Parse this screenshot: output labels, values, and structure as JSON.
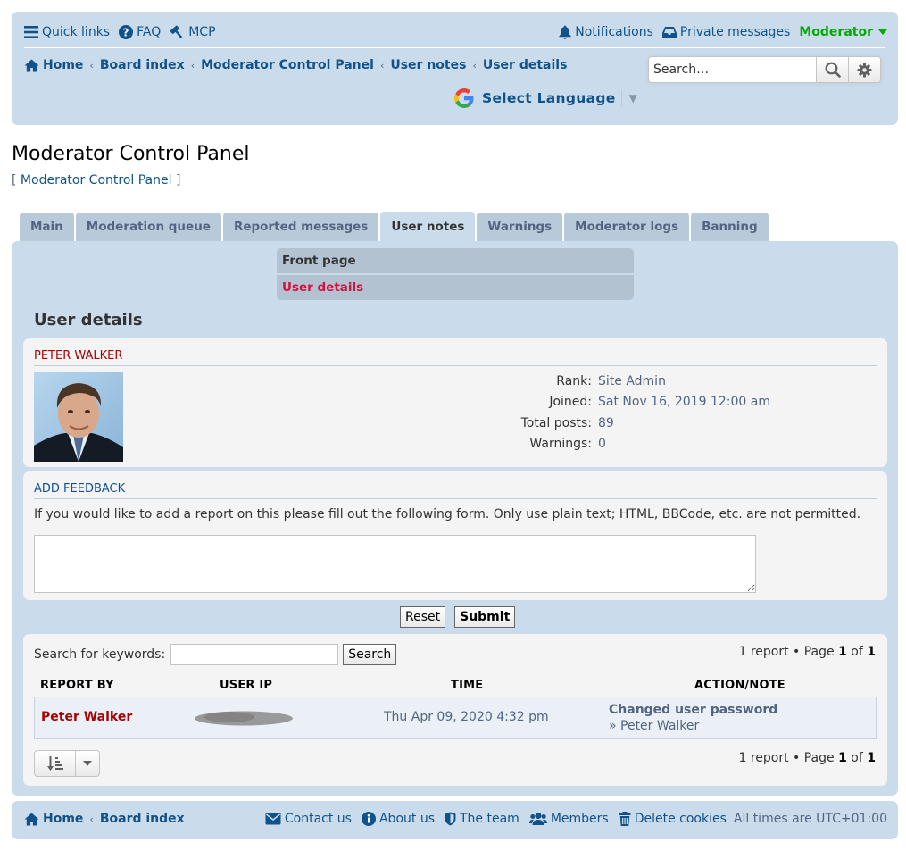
{
  "header": {
    "quick_links": "Quick links",
    "faq": "FAQ",
    "mcp": "MCP",
    "notifications": "Notifications",
    "private_messages": "Private messages",
    "username": "Moderator",
    "breadcrumbs": [
      "Home",
      "Board index",
      "Moderator Control Panel",
      "User notes",
      "User details"
    ],
    "search_placeholder": "Search…",
    "translate_label": "Select Language"
  },
  "page": {
    "title": "Moderator Control Panel",
    "subtitle_link": "Moderator Control Panel",
    "subtitle_open": "[",
    "subtitle_close": "]"
  },
  "tabs": [
    "Main",
    "Moderation queue",
    "Reported messages",
    "User notes",
    "Warnings",
    "Moderator logs",
    "Banning"
  ],
  "active_tab": "User notes",
  "submenu": [
    "Front page",
    "User details"
  ],
  "section_heading": "User details",
  "profile": {
    "name": "PETER WALKER",
    "rank_label": "Rank:",
    "rank": "Site Admin",
    "joined_label": "Joined:",
    "joined": "Sat Nov 16, 2019 12:00 am",
    "posts_label": "Total posts:",
    "posts": "89",
    "warnings_label": "Warnings:",
    "warnings": "0"
  },
  "feedback": {
    "title": "ADD FEEDBACK",
    "instructions": "If you would like to add a report on this please fill out the following form. Only use plain text; HTML, BBCode, etc. are not permitted.",
    "reset_label": "Reset",
    "submit_label": "Submit"
  },
  "notes": {
    "keywords_label": "Search for keywords:",
    "search_label": "Search",
    "pagination_count": "1 report • Page ",
    "page_current": "1",
    "page_of": " of ",
    "page_total": "1",
    "columns": [
      "REPORT BY",
      "USER IP",
      "TIME",
      "ACTION/NOTE"
    ],
    "rows": [
      {
        "report_by": "Peter Walker",
        "time": "Thu Apr 09, 2020 4:32 pm",
        "action": "Changed user password",
        "note": "» Peter Walker"
      }
    ]
  },
  "footer": {
    "breadcrumbs": [
      "Home",
      "Board index"
    ],
    "contact": "Contact us",
    "about": "About us",
    "team": "The team",
    "members": "Members",
    "delete_cookies": "Delete cookies",
    "timezone": "All times are UTC+01:00"
  },
  "colors": {
    "header_bg": "#cadceb",
    "link": "#105289",
    "username_green": "#00AA00",
    "admin_red": "#AA0000",
    "active_submenu": "#d31141"
  },
  "icons": [
    "menu-icon",
    "question-icon",
    "gavel-icon",
    "bell-icon",
    "inbox-icon",
    "home-icon",
    "search-icon",
    "gear-icon",
    "google-icon",
    "envelope-icon",
    "info-icon",
    "shield-icon",
    "users-icon",
    "trash-icon",
    "sort-icon"
  ]
}
